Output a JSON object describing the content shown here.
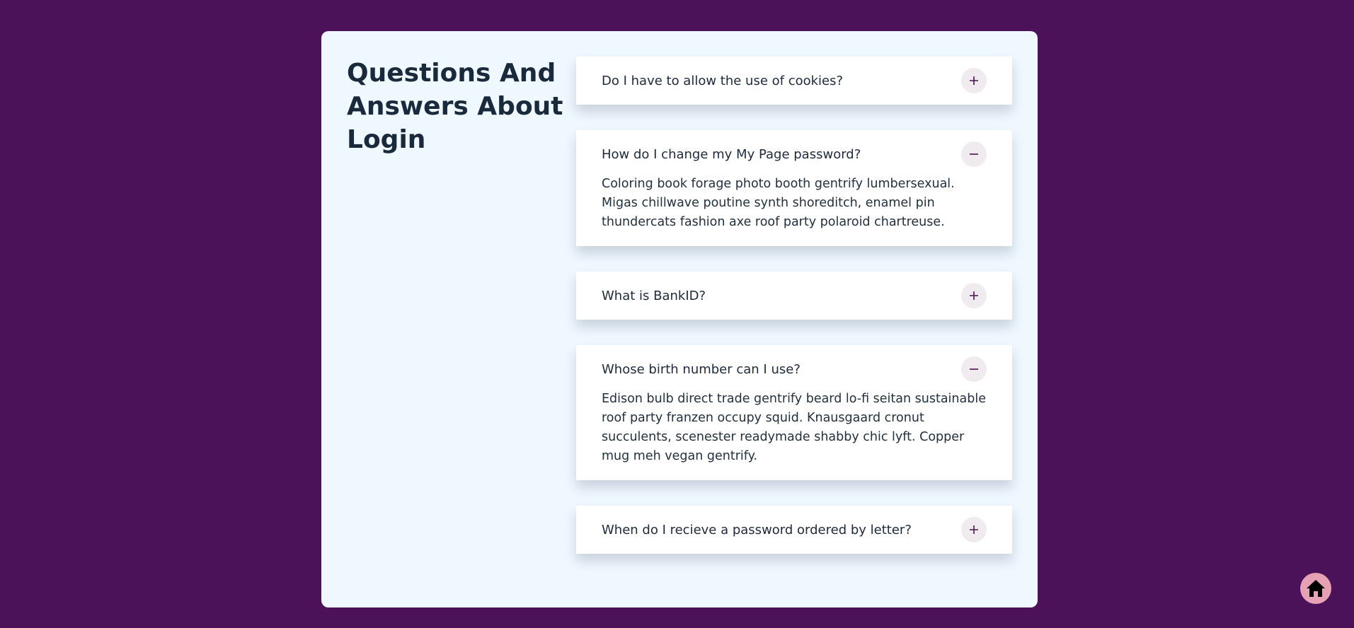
{
  "page": {
    "title": "Questions And Answers About Login"
  },
  "faq": [
    {
      "question": "Do I have to allow the use of cookies?",
      "expanded": false,
      "answer": ""
    },
    {
      "question": "How do I change my My Page password?",
      "expanded": true,
      "answer": "Coloring book forage photo booth gentrify lumbersexual. Migas chillwave poutine synth shoreditch, enamel pin thundercats fashion axe roof party polaroid chartreuse."
    },
    {
      "question": "What is BankID?",
      "expanded": false,
      "answer": ""
    },
    {
      "question": "Whose birth number can I use?",
      "expanded": true,
      "answer": "Edison bulb direct trade gentrify beard lo-fi seitan sustainable roof party franzen occupy squid. Knausgaard cronut succulents, scenester readymade shabby chic lyft. Copper mug meh vegan gentrify."
    },
    {
      "question": "When do I recieve a password ordered by letter?",
      "expanded": false,
      "answer": ""
    }
  ],
  "icons": {
    "expand": "plus-icon",
    "collapse": "minus-icon",
    "home": "home-icon"
  },
  "colors": {
    "background": "#4b1259",
    "card": "#eff7ff",
    "accent": "#4b1259",
    "home_button": "#e7a1b4"
  }
}
